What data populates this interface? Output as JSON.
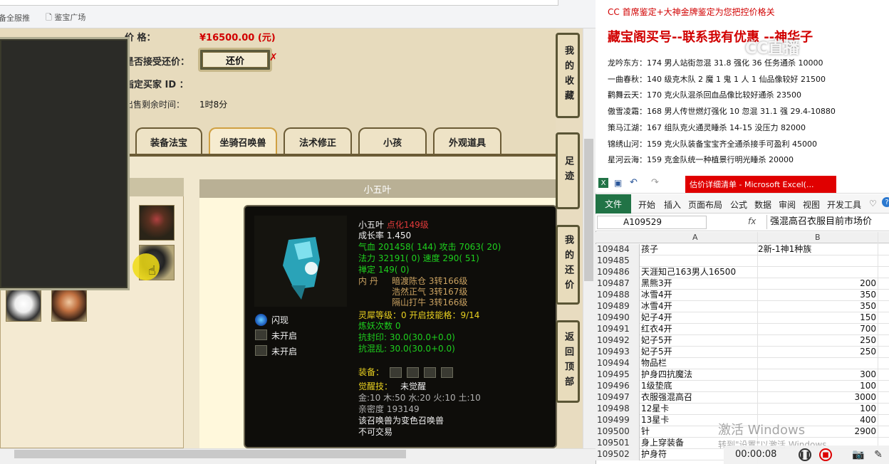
{
  "browser": {
    "bookmark1": "备全服推",
    "bookmark2": "鉴宝广场"
  },
  "trade": {
    "price_label": "价        格：",
    "price_value": "¥16500.00 (元)",
    "counter_label": "是否接受还价：",
    "counter_button": "还价",
    "buyer_label": "指定买家 ID ：",
    "remain_label": "出售剩余时间：",
    "remain_value": "1时8分"
  },
  "tabs": [
    "装备法宝",
    "坐骑召唤兽",
    "法术修正",
    "小孩",
    "外观道具"
  ],
  "pet_panel_title": "小五叶",
  "sidebar_buttons": [
    "我的收藏",
    "足迹",
    "我的还价",
    "返回顶部"
  ],
  "pet": {
    "name": "小五叶",
    "tag": "点化149级",
    "growth": "成长率 1.450",
    "hp": "气血 201458( 144) 攻击 7063( 20)",
    "mp": "法力 32191( 0) 速度 290( 51)",
    "zen": "禅定 149( 0)",
    "dan_label": "内    丹",
    "dan1": "暗渡陈仓 3转166级",
    "dan2": "浩然正气 3转167级",
    "dan3": "隔山打牛 3转166级",
    "spirit": "灵犀等级：0 开启技能格：9/14",
    "refine": "炼妖次数 0",
    "seal": "抗封印: 30.0(30.0+0.0)",
    "chaos": "抗混乱: 30.0(30.0+0.0)",
    "equip_label": "装备：",
    "awaken_label": "觉醒技：",
    "awaken_value": "未觉醒",
    "elements": "金:10 木:50 水:20 火:10 土:10",
    "intimacy": "亲密度 193149",
    "note1": "该召唤兽为变色召唤兽",
    "note2": "不可交易",
    "skills": [
      "闪现",
      "未开启",
      "未开启"
    ]
  },
  "notes": {
    "header1": "CC 首席鉴定+大神金牌鉴定为您把控价格关",
    "header2": "藏宝阁买号--联系我有优惠 --神华子",
    "lines": [
      "龙吟东方：174 男人站街忽混 31.8 强化 36 任务通杀 10000",
      "一曲春秋：140 级克木队 2 魔 1 鬼 1 人 1 仙品像较好 21500",
      "鹳舞云天：170 克火队混杀回血品像比较好通杀 23500",
      "傲雪凌霜：168 男人传世燃灯强化 10 忽混 31.1 强 29.4-10880",
      "策马江湖：167 组队克火通灵睡杀 14-15 没压力 82000",
      "锦绣山河：159 克火队装备宝宝齐全通杀接手可盈利 45000",
      "星河云海：159 克金队统一种植景行明光睡杀 20000"
    ],
    "watermark": "CC直播"
  },
  "excel": {
    "title": "估价详细清单 - Microsoft Excel(...",
    "file_tab": "文件",
    "ribbon": [
      "开始",
      "插入",
      "页面布局",
      "公式",
      "数据",
      "审阅",
      "视图",
      "开发工具"
    ],
    "namebox": "A109529",
    "fx": "fx",
    "formula": "强混高召衣服目前市场价",
    "col_a": "A",
    "col_b": "B",
    "rows": [
      {
        "n": "109484",
        "a": "孩子",
        "b": "2新-1神1种族",
        "v": ""
      },
      {
        "n": "109485",
        "a": "",
        "b": "",
        "v": ""
      },
      {
        "n": "109486",
        "a": "天涯知己163男人16500",
        "b": "",
        "v": ""
      },
      {
        "n": "109487",
        "a": "黑熊3开",
        "b": "",
        "v": "200"
      },
      {
        "n": "109488",
        "a": "冰雪4开",
        "b": "",
        "v": "350"
      },
      {
        "n": "109489",
        "a": "冰雪4开",
        "b": "",
        "v": "350"
      },
      {
        "n": "109490",
        "a": "妃子4开",
        "b": "",
        "v": "150"
      },
      {
        "n": "109491",
        "a": "红衣4开",
        "b": "",
        "v": "700"
      },
      {
        "n": "109492",
        "a": "妃子5开",
        "b": "",
        "v": "250"
      },
      {
        "n": "109493",
        "a": "妃子5开",
        "b": "",
        "v": "250"
      },
      {
        "n": "109494",
        "a": "物品栏",
        "b": "",
        "v": ""
      },
      {
        "n": "109495",
        "a": "护身四抗魔法",
        "b": "",
        "v": "300"
      },
      {
        "n": "109496",
        "a": "1级垫底",
        "b": "",
        "v": "100"
      },
      {
        "n": "109497",
        "a": "衣服强混高召",
        "b": "",
        "v": "3000"
      },
      {
        "n": "109498",
        "a": "12星卡",
        "b": "",
        "v": "100"
      },
      {
        "n": "109499",
        "a": "13星卡",
        "b": "",
        "v": "400"
      },
      {
        "n": "109500",
        "a": "针",
        "b": "",
        "v": "2900"
      },
      {
        "n": "109501",
        "a": "身上穿装备",
        "b": "",
        "v": ""
      },
      {
        "n": "109502",
        "a": "护身符",
        "b": "",
        "v": ""
      }
    ]
  },
  "windows_wm1": "激活 Windows",
  "windows_wm2": "转到\"设置\"以激活 Windows。",
  "recorder_time": "00:00:08"
}
